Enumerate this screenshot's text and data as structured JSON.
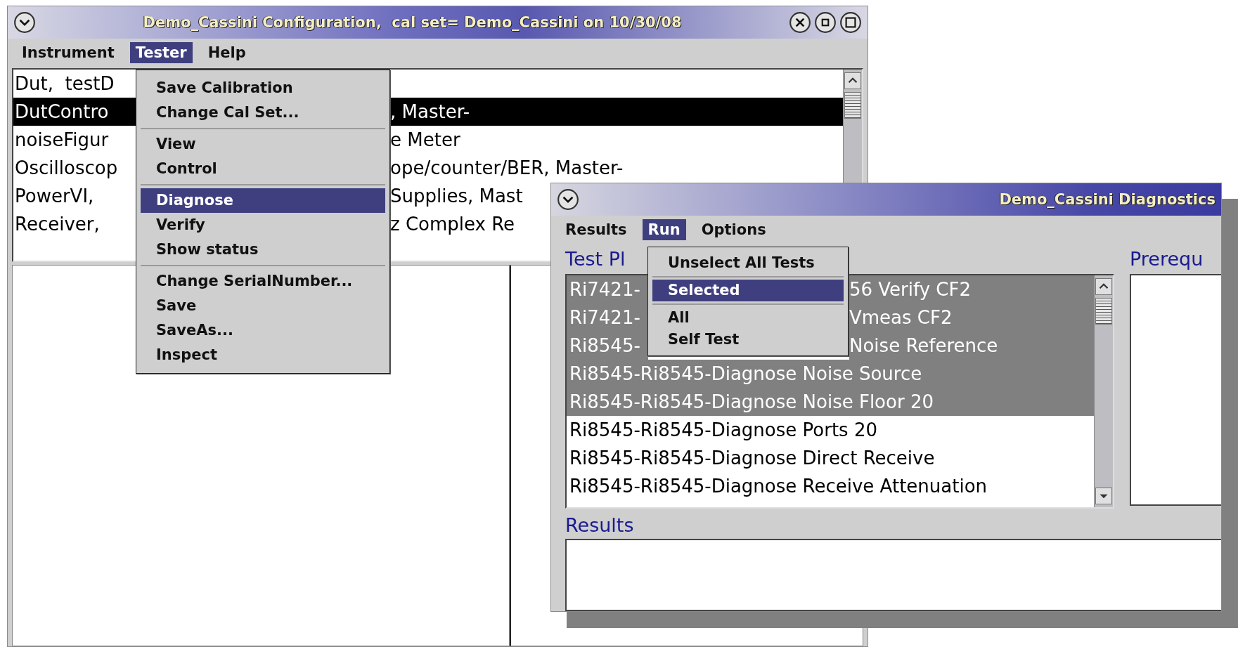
{
  "config_window": {
    "title": "Demo_Cassini Configuration,  cal set= Demo_Cassini on 10/30/08",
    "menubar": [
      {
        "label": "Instrument",
        "selected": false
      },
      {
        "label": "Tester",
        "selected": true
      },
      {
        "label": "Help",
        "selected": false
      }
    ],
    "rows": [
      {
        "left": "Dut,  testD",
        "selected": false
      },
      {
        "left": "DutContro",
        "right": ", Master-",
        "selected": true
      },
      {
        "left": "noiseFigur",
        "right": "e Meter",
        "selected": false
      },
      {
        "left": "Oscilloscop",
        "right": "ope/counter/BER, Master-",
        "selected": false
      },
      {
        "left": "PowerVI,",
        "right": "Supplies, Mast",
        "selected": false
      },
      {
        "left": "Receiver,",
        "right": "z Complex Re",
        "selected": false
      }
    ]
  },
  "tester_menu": {
    "sections": [
      [
        {
          "label": "Save Calibration",
          "selected": false
        },
        {
          "label": "Change Cal Set...",
          "selected": false
        }
      ],
      [
        {
          "label": "View",
          "selected": false
        },
        {
          "label": "Control",
          "selected": false
        }
      ],
      [
        {
          "label": "Diagnose",
          "selected": true
        },
        {
          "label": "Verify",
          "selected": false
        },
        {
          "label": "Show status",
          "selected": false
        }
      ],
      [
        {
          "label": "Change SerialNumber...",
          "selected": false
        },
        {
          "label": "Save",
          "selected": false
        },
        {
          "label": "SaveAs...",
          "selected": false
        },
        {
          "label": "Inspect",
          "selected": false
        }
      ]
    ]
  },
  "diagnostics_window": {
    "title": "Demo_Cassini Diagnostics",
    "menubar": [
      {
        "label": "Results",
        "selected": false
      },
      {
        "label": "Run",
        "selected": true
      },
      {
        "label": "Options",
        "selected": false
      }
    ],
    "test_plan_label": "Test Pl",
    "prerequisites_label": "Prerequ",
    "tests": [
      {
        "left": "Ri7421-",
        "right": "56 Verify CF2",
        "selected": true
      },
      {
        "left": "Ri7421-",
        "right": "Vmeas CF2",
        "selected": true
      },
      {
        "left": "Ri8545-",
        "right": "Noise Reference",
        "selected": true
      },
      {
        "text": "Ri8545-Ri8545-Diagnose Noise Source",
        "selected": true
      },
      {
        "text": "Ri8545-Ri8545-Diagnose Noise Floor 20",
        "selected": true
      },
      {
        "text": "Ri8545-Ri8545-Diagnose Ports 20",
        "selected": false
      },
      {
        "text": "Ri8545-Ri8545-Diagnose Direct Receive",
        "selected": false
      },
      {
        "text": "Ri8545-Ri8545-Diagnose Receive Attenuation",
        "selected": false
      }
    ],
    "results_label": "Results"
  },
  "run_menu": {
    "sections": [
      [
        {
          "label": "Unselect All Tests",
          "selected": false
        }
      ],
      [
        {
          "label": "Selected",
          "selected": true
        }
      ],
      [
        {
          "label": "All",
          "selected": false
        },
        {
          "label": "Self Test",
          "selected": false
        }
      ]
    ]
  }
}
